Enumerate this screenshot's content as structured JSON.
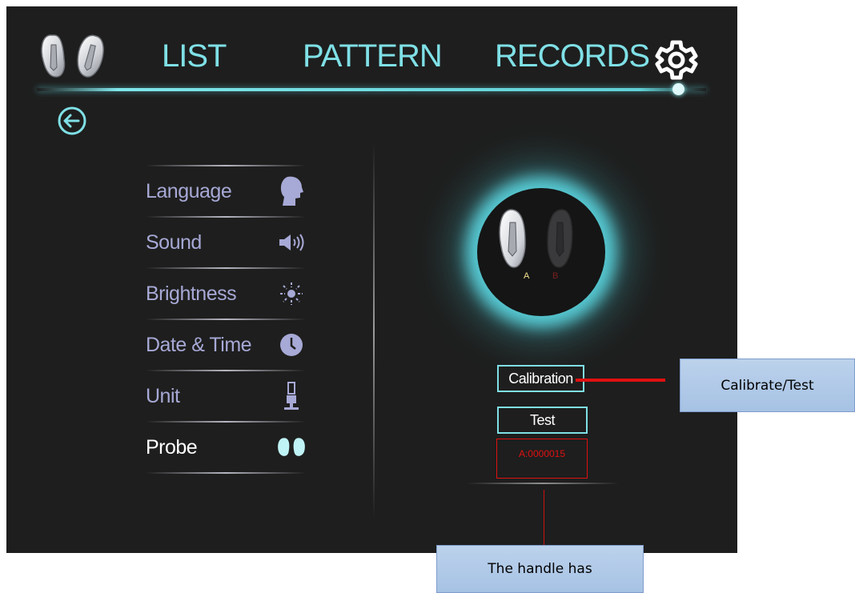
{
  "header": {
    "nav_list": "LIST",
    "nav_pattern": "PATTERN",
    "nav_records": "RECORDS"
  },
  "settings_menu": {
    "items": [
      {
        "label": "Language",
        "icon": "head-profile-icon"
      },
      {
        "label": "Sound",
        "icon": "speaker-icon"
      },
      {
        "label": "Brightness",
        "icon": "brightness-icon"
      },
      {
        "label": "Date & Time",
        "icon": "clock-icon"
      },
      {
        "label": "Unit",
        "icon": "unit-stand-icon"
      },
      {
        "label": "Probe",
        "icon": "probe-icon",
        "active": true
      }
    ]
  },
  "probe_panel": {
    "label_a": "A",
    "label_b": "B",
    "calibration_label": "Calibration",
    "test_label": "Test",
    "counter": "A:0000015"
  },
  "annotations": {
    "calibrate_test": "Calibrate/Test",
    "handle_has": "The handle has"
  },
  "colors": {
    "accent": "#7fe0e6",
    "background": "#1e1e1e",
    "menu_text": "#a7a9d6",
    "alert_red": "#e01010",
    "callout_fill": "#b3cbe8"
  }
}
